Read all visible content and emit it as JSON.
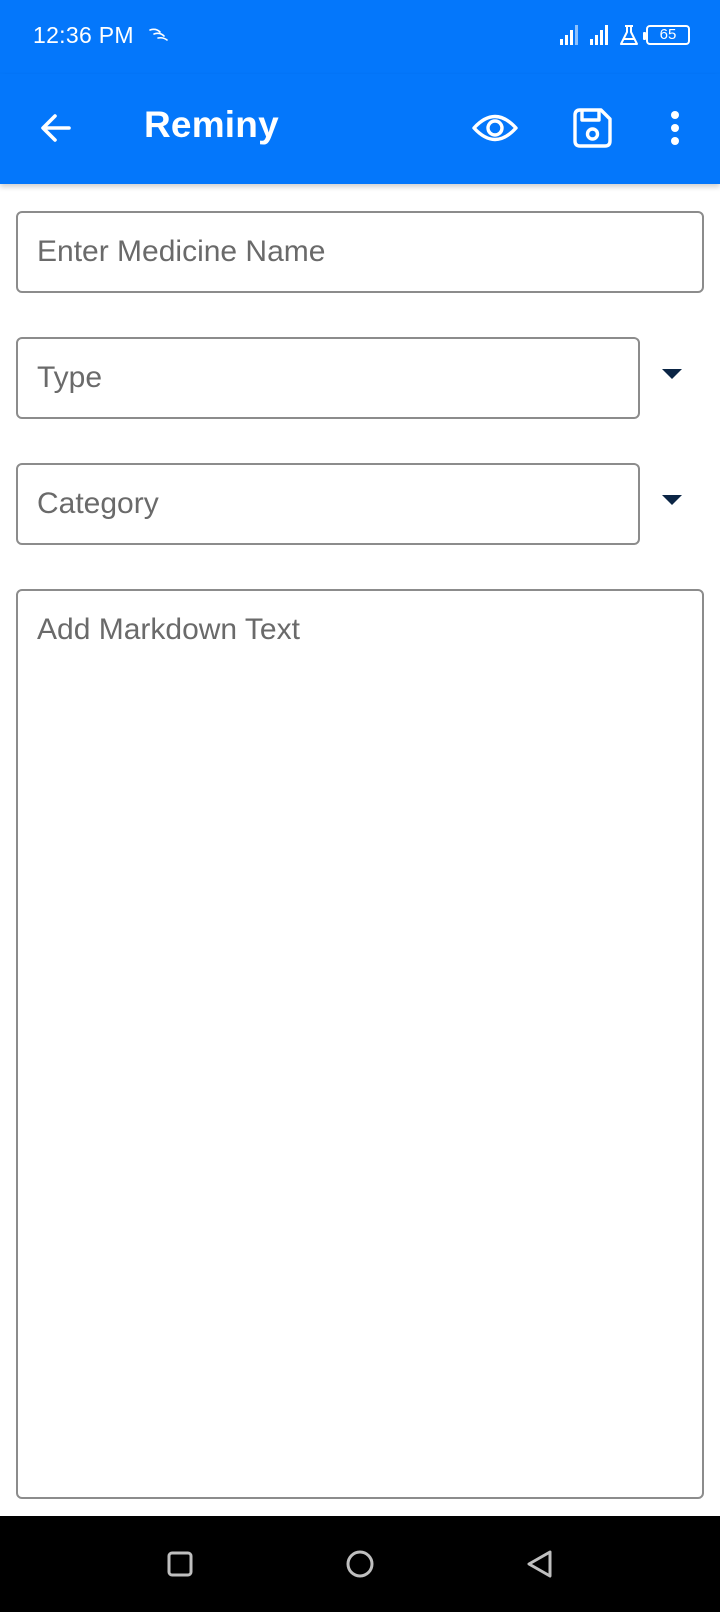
{
  "status_bar": {
    "time": "12:36 PM",
    "battery_level": "65"
  },
  "app_bar": {
    "title": "Reminy",
    "icons": [
      "arrow-left-icon",
      "eye-icon",
      "floppy-disk-icon",
      "more-vert-icon"
    ],
    "background_color": "#0477FB"
  },
  "form": {
    "medicine_name": {
      "value": "",
      "placeholder": "Enter Medicine Name"
    },
    "type": {
      "value": "",
      "placeholder": "Type"
    },
    "category": {
      "value": "",
      "placeholder": "Category"
    },
    "markdown": {
      "value": "",
      "placeholder": "Add Markdown Text"
    }
  },
  "nav_bar": {
    "icons": [
      "square-recents-icon",
      "circle-home-icon",
      "triangle-back-icon"
    ]
  }
}
